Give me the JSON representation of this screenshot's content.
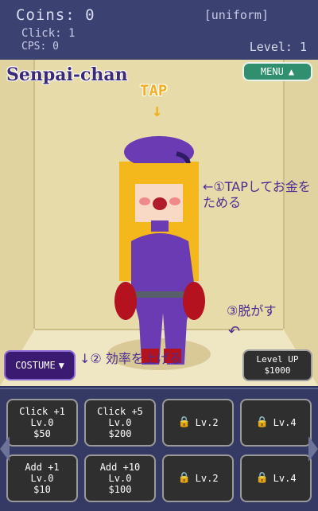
{
  "header": {
    "coins": "Coins: 0",
    "outfit": "[uniform]",
    "clicks": "Click: 1",
    "cps": "CPS: 0",
    "level": "Level: 1"
  },
  "game": {
    "title": "Senpai-chan",
    "menu_label": "MENU",
    "menu_icon": "triangle-up-icon",
    "tap_hint": "TAP",
    "tap_arrow": "↓",
    "note1": "←①TAPしてお金をためる",
    "note2": "↓② 効率を上げる",
    "note3": "③脱がす",
    "note3_arrow": "↶",
    "costume_label": "COSTUME",
    "costume_icon": "▼",
    "levelup_label": "Level UP",
    "levelup_cost": "$1000"
  },
  "upgrades": [
    {
      "name": "Click +1",
      "level": "Lv.0",
      "cost": "$50"
    },
    {
      "name": "Click +5",
      "level": "Lv.0",
      "cost": "$200"
    },
    {
      "locked": true,
      "unlock": "Lv.2"
    },
    {
      "locked": true,
      "unlock": "Lv.4"
    },
    {
      "name": "Add +1",
      "level": "Lv.0",
      "cost": "$10"
    },
    {
      "name": "Add +10",
      "level": "Lv.0",
      "cost": "$100"
    },
    {
      "locked": true,
      "unlock": "Lv.2"
    },
    {
      "locked": true,
      "unlock": "Lv.4"
    }
  ],
  "colors": {
    "accent": "#2f8f6f",
    "costume": "#3b1a72",
    "suit": "#6a3bb3",
    "hair": "#f4b81c"
  }
}
